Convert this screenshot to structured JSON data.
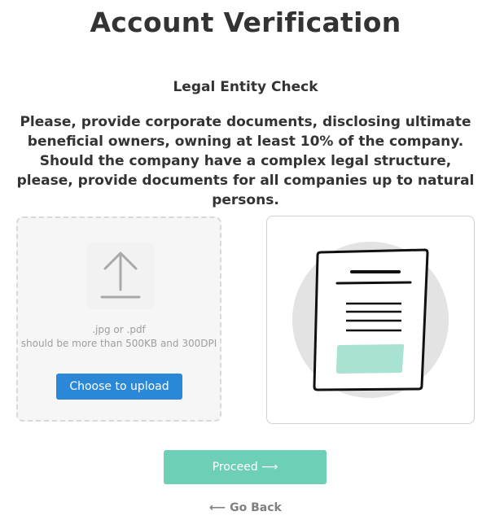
{
  "page": {
    "title": "Account Verification",
    "subtitle": "Legal Entity Check",
    "instructions": "Please, provide corporate documents, disclosing ultimate beneficial owners, owning at least 10% of the company. Should the company have a complex legal structure, please, provide documents for all companies up to natural persons."
  },
  "upload": {
    "icon": "upload-arrow-icon",
    "formats": ".jpg or .pdf",
    "requirements": "should be more than 500KB and 300DPI",
    "button_label": "Choose to upload",
    "button_color": "#2b88d9"
  },
  "preview": {
    "icon": "document-illustration-icon",
    "accent_color": "#a8e2d2"
  },
  "actions": {
    "proceed_label": "Proceed ⟶",
    "proceed_color": "#6ecfb7",
    "back_label": "⟵ Go Back"
  }
}
